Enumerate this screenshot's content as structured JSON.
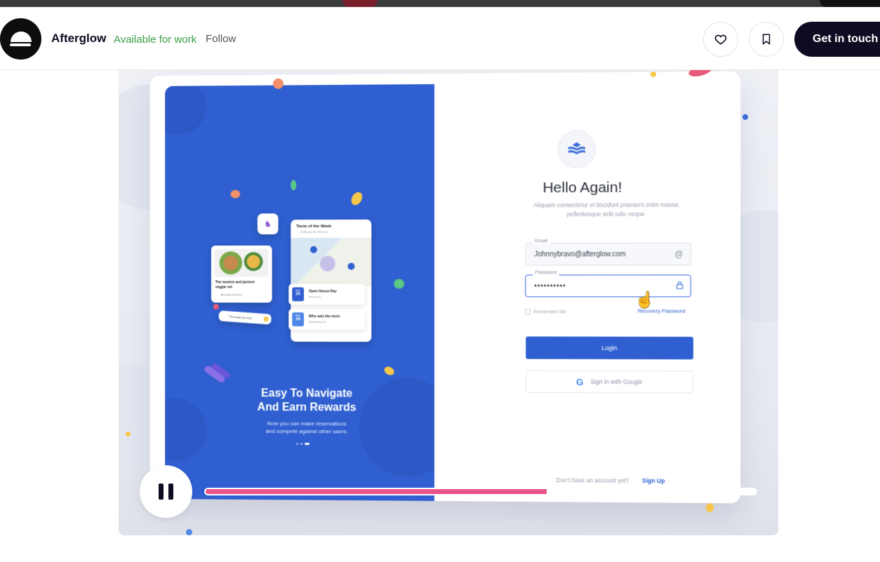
{
  "header": {
    "brand_name": "Afterglow",
    "availability": "Available for work",
    "follow_label": "Follow",
    "like_icon": "heart-icon",
    "save_icon": "bookmark-icon",
    "contact_label": "Get in touch"
  },
  "shot": {
    "left_panel": {
      "headline_line1": "Easy To Navigate",
      "headline_line2": "And Earn Rewards",
      "subline_line1": "Now you can make reservations",
      "subline_line2": "and compete against other users.",
      "card_title": "Taste of the Week",
      "card_address": "66 Elevator Bst, Montreal",
      "event1_title": "Open House Day",
      "event1_sub": "Free Event",
      "event1_month": "DEC",
      "event1_day": "25",
      "event2_title": "Who eats the most",
      "event2_sub": "Membership fee",
      "event2_month": "DEC",
      "event2_day": "26",
      "food_title": "The tastiest and juiciest veggie set",
      "food_author": "Alexander Kaufman",
      "chip_text": "This week you won"
    },
    "login": {
      "title": "Hello Again!",
      "description": "Aliquam consectetur et tincidunt praesent enim massa pellentesque velit odio neque",
      "email_label": "Email",
      "email_value": "Johnnybravo@afterglow.com",
      "password_label": "Password",
      "password_value": "••••••••••",
      "remember_label": "Remember Me",
      "recover_label": "Recovery Password",
      "login_label": "Login",
      "google_label": "Sign in with Google",
      "no_account": "Don't have an account yet?",
      "signup_label": "Sign Up"
    }
  },
  "player": {
    "state": "playing",
    "progress_percent": 62
  },
  "colors": {
    "brand_blue": "#2f5fd0",
    "progress_pink": "#e8538a",
    "available_green": "#3a9e48",
    "dark": "#0d0c22"
  }
}
